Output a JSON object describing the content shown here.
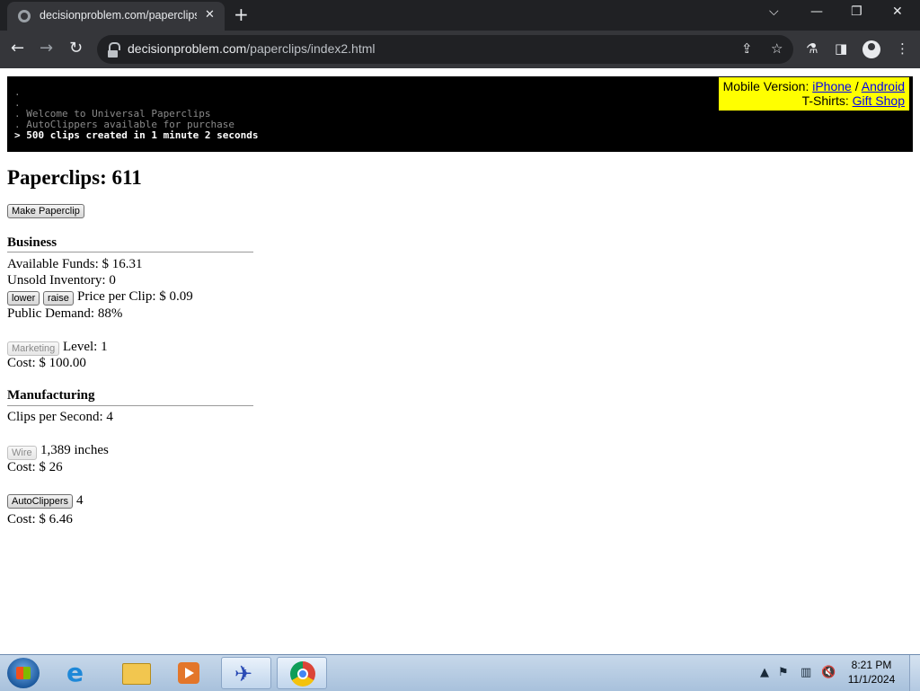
{
  "browser": {
    "tab_title": "decisionproblem.com/paperclips",
    "tab_close": "✕",
    "new_tab": "+",
    "url_host": "decisionproblem.com",
    "url_path": "/paperclips/index2.html",
    "window_controls": {
      "list": "⌵",
      "minimize": "—",
      "restore": "❐",
      "close": "✕"
    },
    "nav": {
      "back": "←",
      "forward": "→",
      "reload": "↻"
    },
    "icons": {
      "share": "⇪",
      "bookmark": "☆",
      "labs": "⚗",
      "sidepanel": "◨",
      "menu": "⋮"
    }
  },
  "console": {
    "lines": [
      ".",
      ".",
      ". Welcome to Universal Paperclips",
      ". AutoClippers available for purchase"
    ],
    "current": "> 500 clips created in 1 minute 2 seconds"
  },
  "mobile_links": {
    "mobile_label": "Mobile Version:",
    "iphone": "iPhone",
    "sep": "/",
    "android": "Android",
    "tshirts_label": "T-Shirts:",
    "gift_shop": "Gift Shop"
  },
  "game": {
    "clips_title": "Paperclips: 611",
    "make_button": "Make Paperclip",
    "business": {
      "heading": "Business",
      "funds": "Available Funds: $ 16.31",
      "inventory": "Unsold Inventory: 0",
      "lower": "lower",
      "raise": "raise",
      "price": "Price per Clip: $ 0.09",
      "demand": "Public Demand: 88%",
      "marketing_button": "Marketing",
      "marketing_level": "Level: 1",
      "marketing_cost": "Cost: $ 100.00"
    },
    "manufacturing": {
      "heading": "Manufacturing",
      "clips_per_second": "Clips per Second: 4",
      "wire_button": "Wire",
      "wire_amount": "1,389 inches",
      "wire_cost": "Cost: $ 26",
      "autoclippers_button": "AutoClippers",
      "autoclippers_count": "4",
      "autoclippers_cost": "Cost: $ 6.46"
    }
  },
  "taskbar": {
    "tray_icons": [
      "▲",
      "⚑",
      "▥",
      "🔇"
    ],
    "time": "8:21 PM",
    "date": "11/1/2024"
  }
}
